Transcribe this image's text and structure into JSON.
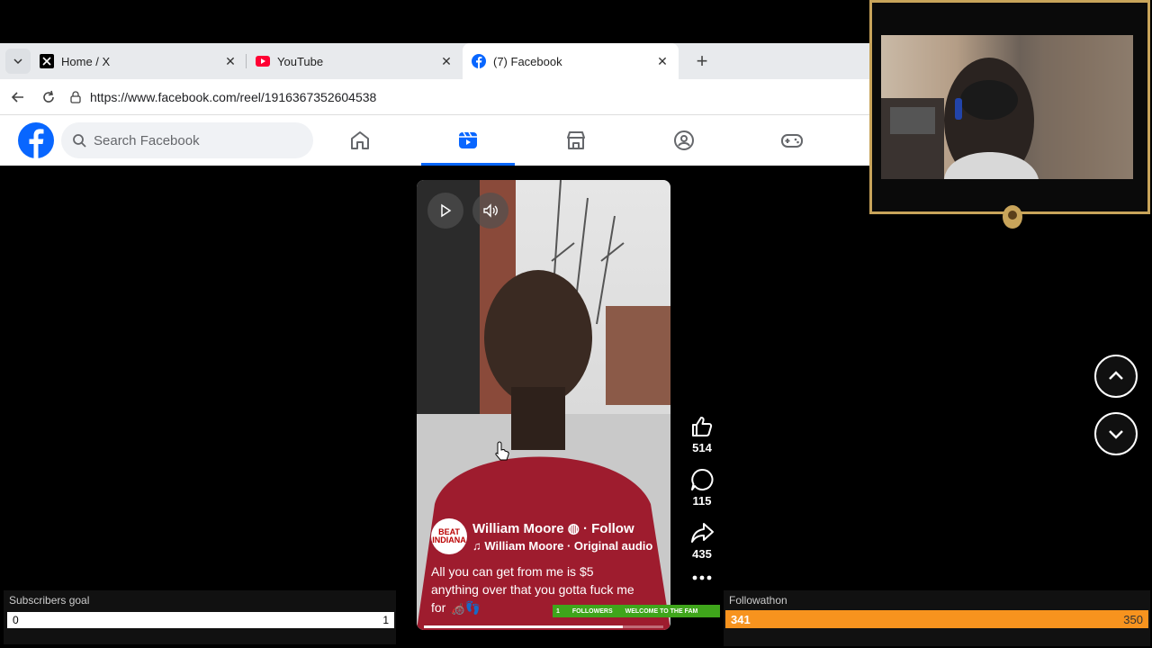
{
  "browser": {
    "tabs": [
      {
        "title": "Home / X",
        "icon": "x-logo-icon"
      },
      {
        "title": "YouTube",
        "icon": "youtube-logo-icon"
      },
      {
        "title": "(7) Facebook",
        "icon": "facebook-logo-icon",
        "active": true
      }
    ],
    "url": "https://www.facebook.com/reel/1916367352604538"
  },
  "facebook": {
    "search_placeholder": "Search Facebook",
    "nav": [
      "home-icon",
      "reels-icon",
      "marketplace-icon",
      "groups-icon",
      "gaming-icon"
    ],
    "active_nav": "reels-icon",
    "brand_color": "#0866ff"
  },
  "reel": {
    "avatar_text": "BEAT INDIANA",
    "owner_name": "William Moore",
    "follow_label": "· Follow",
    "audio": "William Moore · Original audio",
    "caption_line1": "All you can get from me is $5",
    "caption_line2": "anything over that you gotta fuck me",
    "caption_line3": "for 🦽👣",
    "progress": 0.83
  },
  "actions": {
    "likes": "514",
    "comments": "115",
    "shares": "435"
  },
  "overlay": {
    "subs_label": "Subscribers goal",
    "subs_current": "0",
    "subs_goal": "1",
    "follow_label": "Followathon",
    "follow_current": "341",
    "follow_goal": "350",
    "follow_color": "#f7931e",
    "ticker_count": "1",
    "ticker_label": "FOLLOWERS",
    "ticker_msg": "WELCOME TO THE FAM"
  }
}
